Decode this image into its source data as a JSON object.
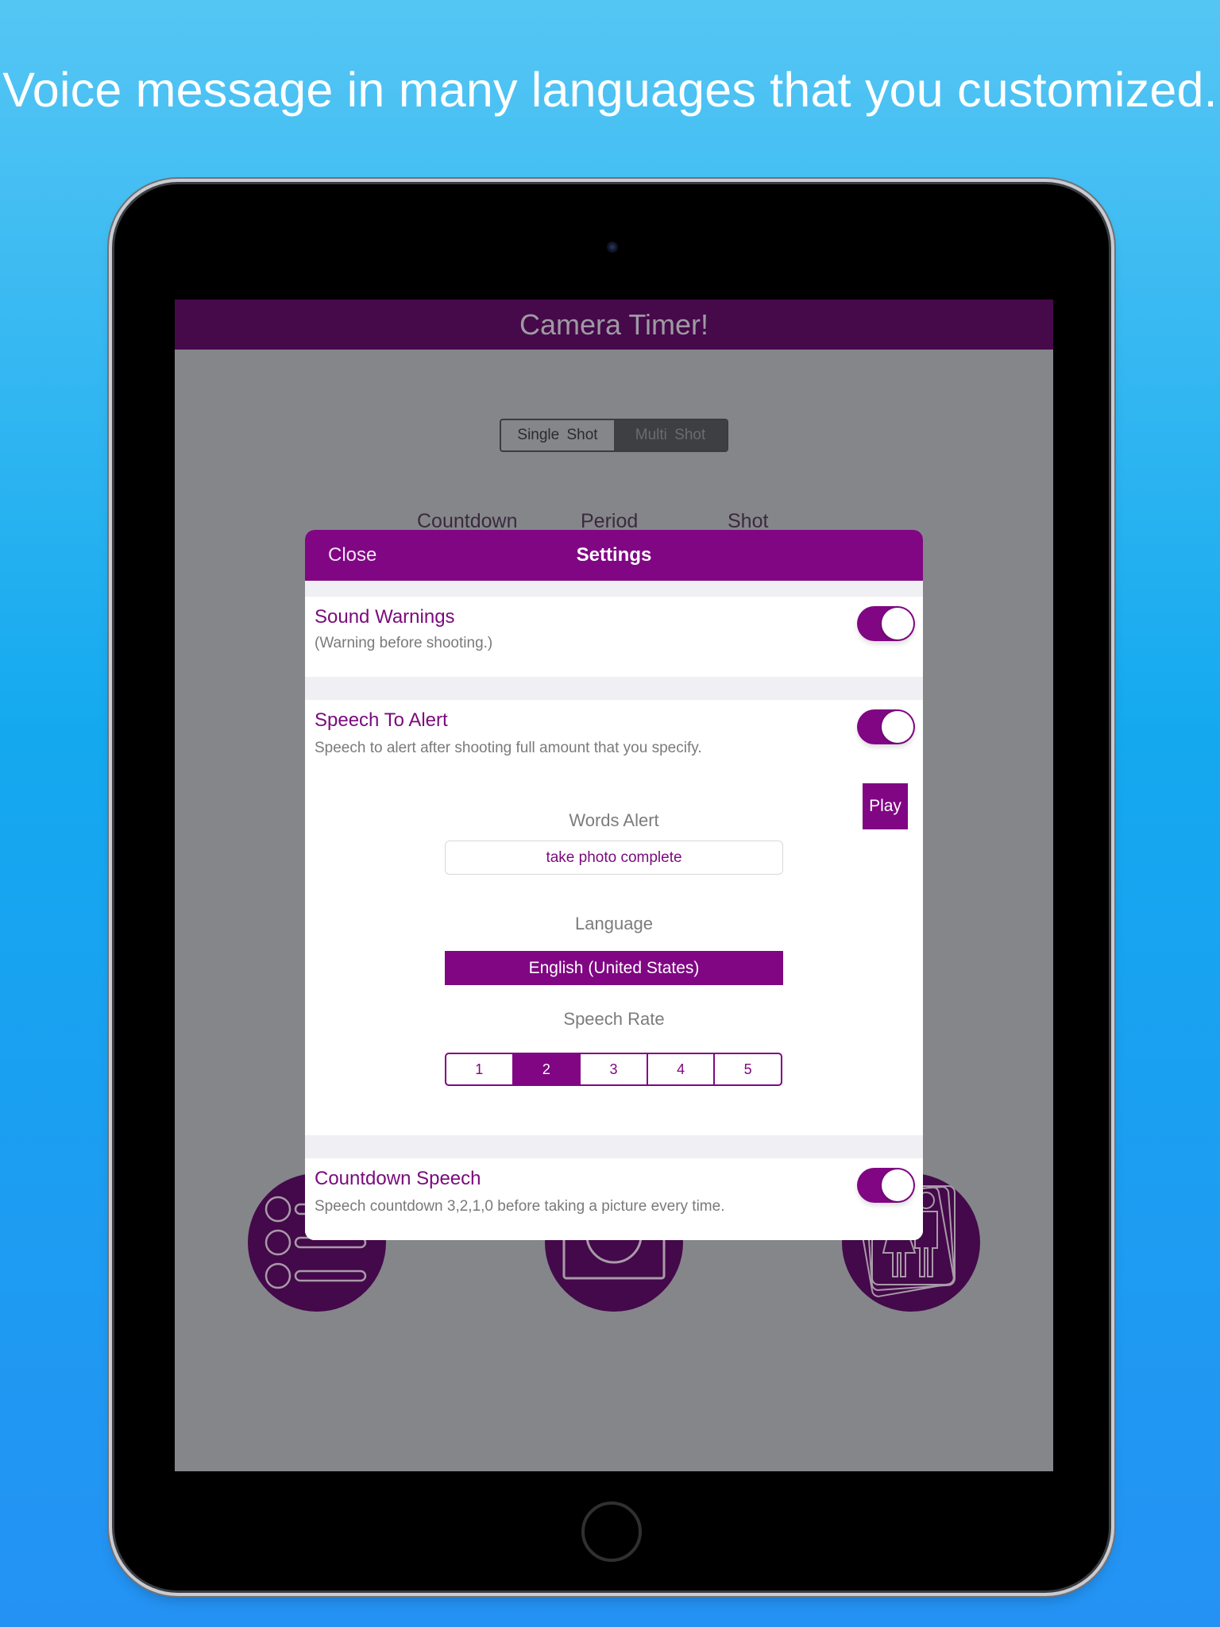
{
  "headline": "Voice message in many languages that you customized.",
  "app": {
    "title": "Camera Timer!",
    "mode_segments": [
      {
        "label": "Single  Shot",
        "selected": false
      },
      {
        "label": "Multi  Shot",
        "selected": true
      }
    ],
    "column_labels": [
      "Countdown",
      "Period",
      "Shot"
    ],
    "circle_buttons": [
      {
        "icon": "list-icon"
      },
      {
        "icon": "camera-icon"
      },
      {
        "icon": "photos-people-icon"
      }
    ]
  },
  "settings": {
    "close_label": "Close",
    "title": "Settings",
    "accent_color": "#800683",
    "sound_warnings": {
      "title": "Sound Warnings",
      "subtitle": "(Warning before shooting.)",
      "enabled": true
    },
    "speech_to_alert": {
      "title": "Speech To Alert",
      "subtitle": "Speech to alert after shooting full amount that you specify.",
      "enabled": true,
      "play_label": "Play",
      "words_alert_label": "Words Alert",
      "words_alert_value": "take photo complete",
      "language_label": "Language",
      "language_value": "English (United States)",
      "speech_rate_label": "Speech Rate",
      "speech_rate_options": [
        "1",
        "2",
        "3",
        "4",
        "5"
      ],
      "speech_rate_selected": "2"
    },
    "countdown_speech": {
      "title": "Countdown Speech",
      "subtitle": "Speech countdown 3,2,1,0 before taking a picture every time.",
      "enabled": true
    }
  }
}
